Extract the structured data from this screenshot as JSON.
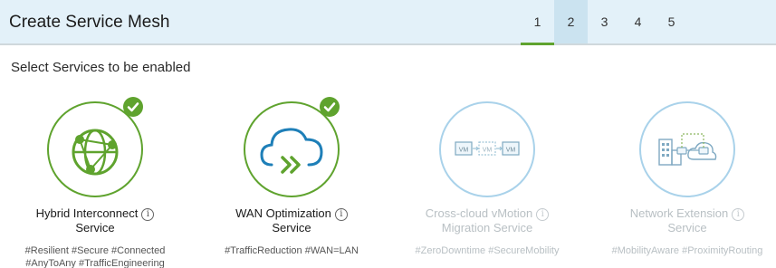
{
  "header": {
    "title": "Create Service Mesh",
    "steps": [
      "1",
      "2",
      "3",
      "4",
      "5"
    ],
    "active_step": "1"
  },
  "subtitle": "Select Services to be enabled",
  "services": [
    {
      "name": "Hybrid Interconnect",
      "name_line2": "Service",
      "tags_line1": "#Resilient #Secure #Connected",
      "tags_line2": "#AnyToAny #TrafficEngineering",
      "selected": true,
      "icon": "globe-network-icon"
    },
    {
      "name": "WAN Optimization",
      "name_line2": "Service",
      "tags_line1": "#TrafficReduction #WAN=LAN",
      "tags_line2": "",
      "selected": true,
      "icon": "cloud-optimization-icon"
    },
    {
      "name": "Cross-cloud vMotion",
      "name_line2": "Migration Service",
      "tags_line1": "#ZeroDowntime #SecureMobility",
      "tags_line2": "",
      "selected": false,
      "icon": "vm-migration-icon"
    },
    {
      "name": "Network Extension",
      "name_line2": "Service",
      "tags_line1": "#MobilityAware #ProximityRouting",
      "tags_line2": "",
      "selected": false,
      "icon": "network-extension-icon"
    }
  ],
  "vm_label": "VM",
  "colors": {
    "accent": "#5fa32e",
    "disabled": "#b9c0c4",
    "header_bg": "#e3f1f9"
  }
}
